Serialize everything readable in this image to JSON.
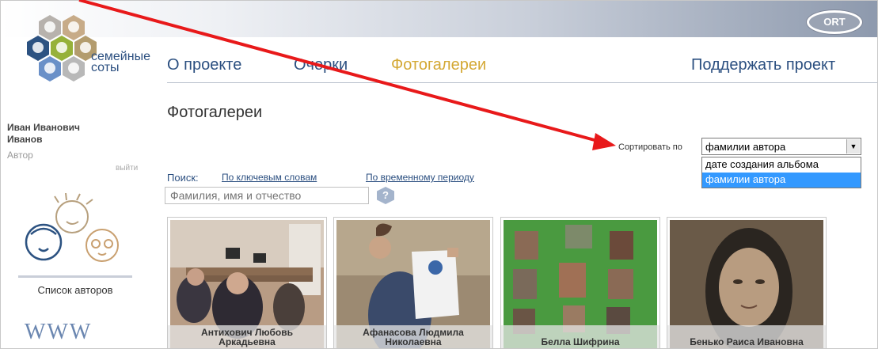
{
  "header": {
    "ort_logo": "ORT"
  },
  "brand": {
    "line1": "семейные",
    "line2": "соты"
  },
  "user": {
    "name1": "Иван Иванович",
    "name2": "Иванов",
    "role": "Автор",
    "logout": "выйти"
  },
  "nav": {
    "items": [
      "О проекте",
      "Очерки",
      "Фотогалереи"
    ],
    "support": "Поддержать проект",
    "active": "Фотогалереи"
  },
  "page": {
    "title": "Фотогалереи"
  },
  "sort": {
    "label": "Сортировать по",
    "value": "фамилии автора",
    "options": [
      "дате создания альбома",
      "фамилии автора"
    ],
    "selected_option": "фамилии автора"
  },
  "search": {
    "label": "Поиск:",
    "by_keywords": "По ключевым словам",
    "by_period": "По временному периоду",
    "placeholder": "Фамилия, имя и отчество",
    "help": "?"
  },
  "sidebar": {
    "authors_list": "Список авторов",
    "www": "WWW"
  },
  "galleries": [
    {
      "line1": "Антихович Любовь",
      "line2": "Аркадьевна"
    },
    {
      "line1": "Афанасова Людмила",
      "line2": "Николаевна"
    },
    {
      "line1": "Белла Шифрина",
      "line2": ""
    },
    {
      "line1": "Бенько Раиса Ивановна",
      "line2": ""
    }
  ],
  "colors": {
    "nav": "#2b4f80",
    "nav_active": "#d4a834",
    "arrow": "#e8191a",
    "selected_option": "#3399ff"
  }
}
